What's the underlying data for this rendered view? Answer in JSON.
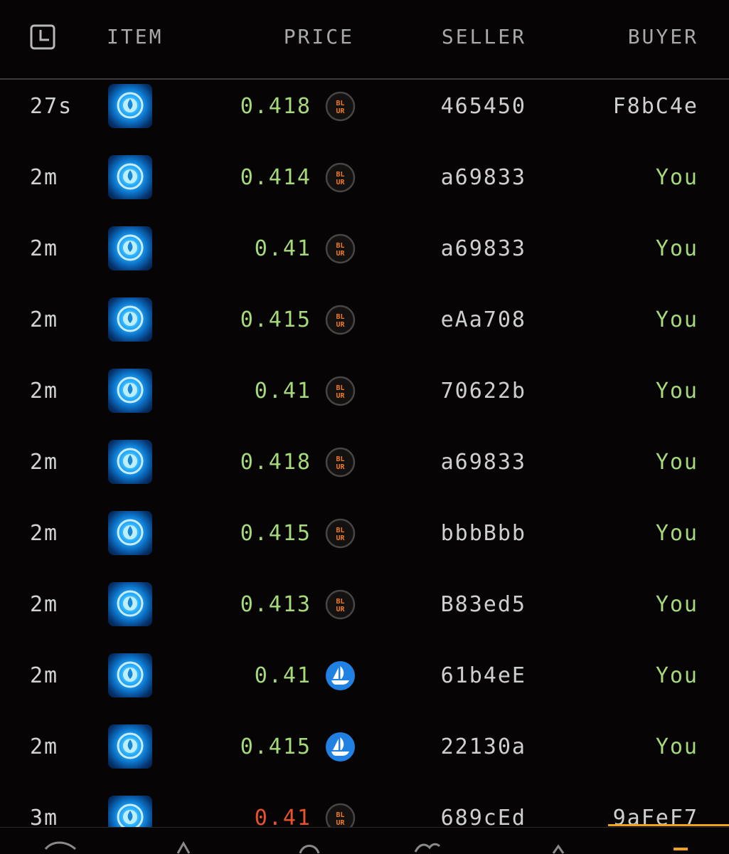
{
  "header": {
    "time_icon": "clock-icon",
    "item": "ITEM",
    "price": "PRICE",
    "seller": "SELLER",
    "buyer": "BUYER"
  },
  "colors": {
    "background": "#060405",
    "price_green": "#a6d97a",
    "price_red": "#e8532a",
    "blur_orange": "#f07a1a",
    "opensea_blue": "#2081e2",
    "accent": "#f0a21e"
  },
  "rows": [
    {
      "time": "27s",
      "price": "0.418",
      "price_color": "green",
      "market": "blur",
      "market_label_top": "BL",
      "market_label_bottom": "UR",
      "seller": "465450",
      "buyer": "F8bC4e",
      "buyer_is_you": false
    },
    {
      "time": "2m",
      "price": "0.414",
      "price_color": "green",
      "market": "blur",
      "market_label_top": "BL",
      "market_label_bottom": "UR",
      "seller": "a69833",
      "buyer": "You",
      "buyer_is_you": true
    },
    {
      "time": "2m",
      "price": "0.41",
      "price_color": "green",
      "market": "blur",
      "market_label_top": "BL",
      "market_label_bottom": "UR",
      "seller": "a69833",
      "buyer": "You",
      "buyer_is_you": true
    },
    {
      "time": "2m",
      "price": "0.415",
      "price_color": "green",
      "market": "blur",
      "market_label_top": "BL",
      "market_label_bottom": "UR",
      "seller": "eAa708",
      "buyer": "You",
      "buyer_is_you": true
    },
    {
      "time": "2m",
      "price": "0.41",
      "price_color": "green",
      "market": "blur",
      "market_label_top": "BL",
      "market_label_bottom": "UR",
      "seller": "70622b",
      "buyer": "You",
      "buyer_is_you": true
    },
    {
      "time": "2m",
      "price": "0.418",
      "price_color": "green",
      "market": "blur",
      "market_label_top": "BL",
      "market_label_bottom": "UR",
      "seller": "a69833",
      "buyer": "You",
      "buyer_is_you": true
    },
    {
      "time": "2m",
      "price": "0.415",
      "price_color": "green",
      "market": "blur",
      "market_label_top": "BL",
      "market_label_bottom": "UR",
      "seller": "bbbBbb",
      "buyer": "You",
      "buyer_is_you": true
    },
    {
      "time": "2m",
      "price": "0.413",
      "price_color": "green",
      "market": "blur",
      "market_label_top": "BL",
      "market_label_bottom": "UR",
      "seller": "B83ed5",
      "buyer": "You",
      "buyer_is_you": true
    },
    {
      "time": "2m",
      "price": "0.41",
      "price_color": "green",
      "market": "opensea",
      "market_label_top": "",
      "market_label_bottom": "",
      "seller": "61b4eE",
      "buyer": "You",
      "buyer_is_you": true
    },
    {
      "time": "2m",
      "price": "0.415",
      "price_color": "green",
      "market": "opensea",
      "market_label_top": "",
      "market_label_bottom": "",
      "seller": "22130a",
      "buyer": "You",
      "buyer_is_you": true
    },
    {
      "time": "3m",
      "price": "0.41",
      "price_color": "red",
      "market": "blur",
      "market_label_top": "BL",
      "market_label_bottom": "UR",
      "seller": "689cEd",
      "buyer": "9aFeF7",
      "buyer_is_you": false
    }
  ],
  "bottom_nav": [
    {
      "icon": "nav-chart-icon"
    },
    {
      "icon": "nav-up-icon"
    },
    {
      "icon": "nav-arc-icon"
    },
    {
      "icon": "nav-swap-icon"
    },
    {
      "icon": "nav-caret-icon"
    },
    {
      "icon": "nav-activity-icon",
      "active": true
    }
  ]
}
